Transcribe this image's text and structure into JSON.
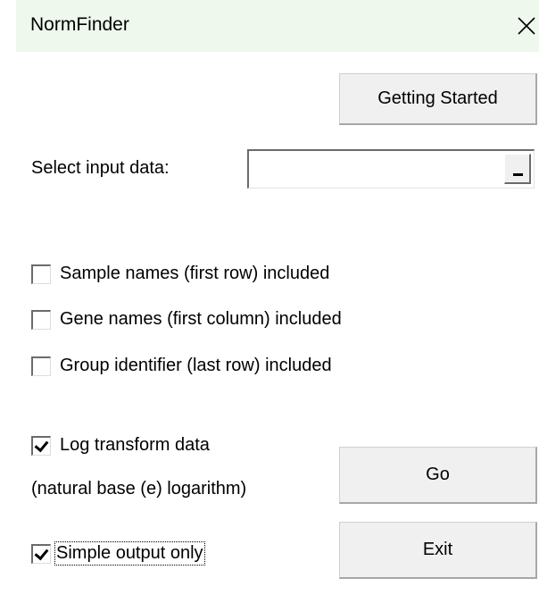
{
  "window": {
    "title": "NormFinder",
    "close_glyph": "✕",
    "titlebar_color": "#eef8ec"
  },
  "buttons": {
    "getting_started": "Getting Started",
    "go": "Go",
    "exit": "Exit"
  },
  "input": {
    "label": "Select input data:",
    "value": "",
    "ref_button_glyph": "_"
  },
  "options": [
    {
      "label": "Sample names (first row) included",
      "checked": false
    },
    {
      "label": "Gene names (first column) included",
      "checked": false
    },
    {
      "label": "Group identifier (last row) included",
      "checked": false
    }
  ],
  "log_transform": {
    "label": "Log transform data",
    "note": "(natural base (e) logarithm)",
    "checked": true
  },
  "simple_output": {
    "label": "Simple output only",
    "checked": true
  }
}
